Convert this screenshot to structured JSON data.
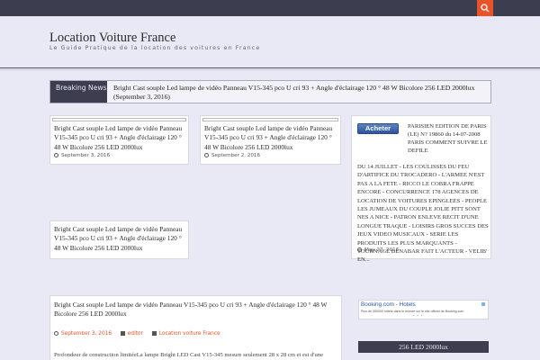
{
  "site": {
    "title": "Location Voiture France",
    "tagline": "Le Guide Pratique de la location des voitures en France"
  },
  "breaking": {
    "label": "Breaking News",
    "text": "Bright Cast souple Led lampe de vidéo Panneau V15-345 pco U cri 93 + Angle d'éclairage 120 ° 48 W Bicolore 256 LED 2000lux (September 3, 2016)"
  },
  "cards": [
    {
      "title": "Bright Cast souple Led lampe de vidéo Panneau V15-345 pco U cri 93 + Angle d'éclairage 120 ° 48 W Bicolore 256 LED 2000lux",
      "date": "September 3, 2016"
    },
    {
      "title": "Bright Cast souple Led lampe de vidéo Panneau V15-345 pco U cri 93 + Angle d'éclairage 120 ° 48 W Bicolore 256 LED 2000lux",
      "date": "September 2, 2016"
    },
    {
      "title": "Bright Cast souple Led lampe de vidéo Panneau V15-345 pco U cri 93 + Angle d'éclairage 120 ° 48 W Bicolore 256 LED 2000lux",
      "date": ""
    }
  ],
  "sidebar_post": {
    "button_label": "Acheter",
    "text_lead": "PARISIEN EDITION DE PARIS (LE) N? 19860 du 14-07-2008 PARIS COMMENT SUIVRE LE DEFILE",
    "text_rest": "DU 14 JUILLET - LES COULISSES DU FEU D'ARTIFICE DU TROCADERO - L'ARMEE N'EST PAS A LA FETE - RICCO LE COBRA FRAPPE ENCORE - CONCURRENCE 178 AGENCES DE LOCATION DE VOITURES EPINGLEES - PEOPLE LES JUMEAUX DU COUPLE JOLIE PITT SONT NES A NICE - PATRON ENLEVE RECIT D'UNE LONGUE TRAQUE - LOISIRS GROS SUCCES DES JEUX VIDEO MUSICAUX - SERIE LES PRODUITS LES PLUS MARQUANTS - TOURNAGE BENABAR FAIT L'ACTEUR - VELIB' EN...",
    "date": "May 27, 2016"
  },
  "post": {
    "title": "Bright Cast souple Led lampe de vidéo Panneau V15-345 pco U cri 93 + Angle d'éclairage 120 ° 48 W Bicolore 256 LED 2000lux",
    "date": "September 3, 2016",
    "author": "editor",
    "category": "Location voiture France",
    "body": "Profondeur de construction limitéeLa lampe Bright LED Cast V15-345 mesure seulement 28 x 28 cm et est d'une épaisseur de"
  },
  "ad": {
    "logo": "Booking.com - Hotels",
    "text": "Plus de 350000 hôtels dans le monde sur le site officiel de Booking.com",
    "dots": "• • •"
  },
  "widget": {
    "title": "256 LED 2000lux"
  },
  "colors": {
    "accent": "#e8542a",
    "dark": "#3d3d50",
    "background": "#e9e9f5"
  }
}
